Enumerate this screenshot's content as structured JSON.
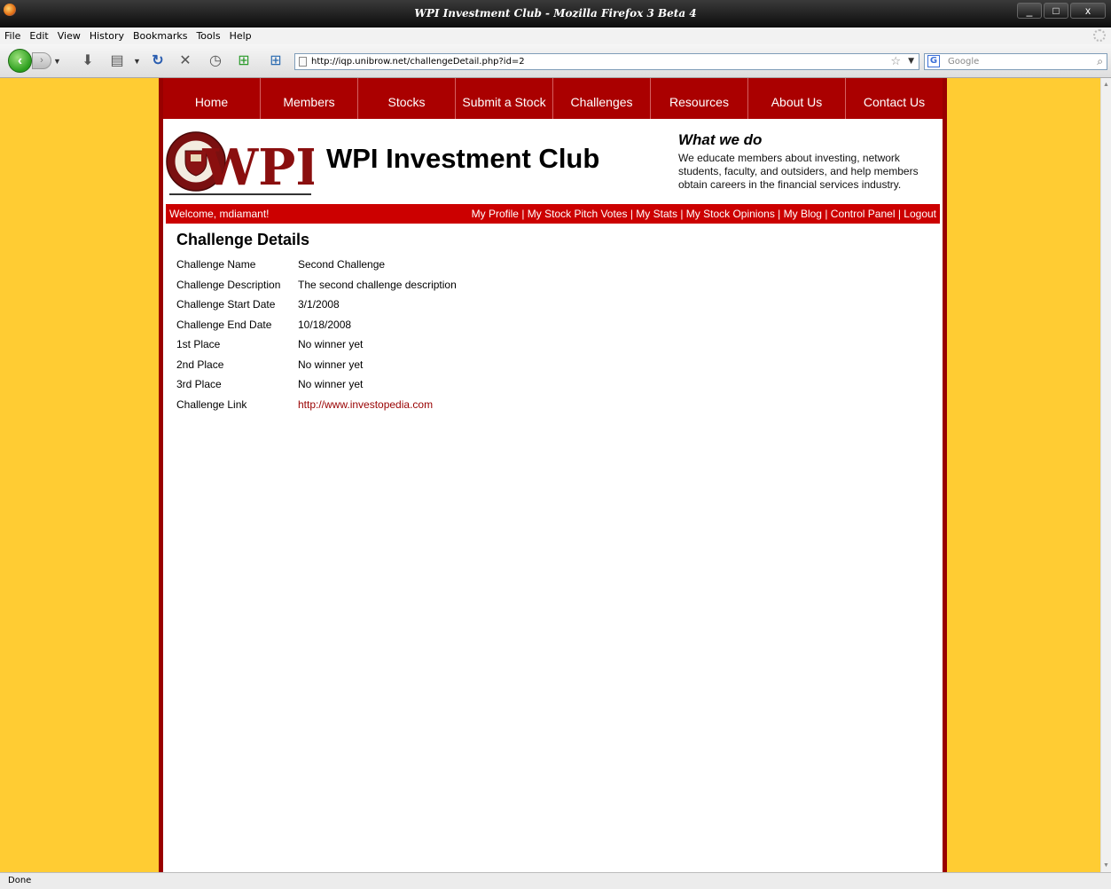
{
  "window": {
    "title": "WPI Investment Club - Mozilla Firefox 3 Beta 4",
    "minimize": "_",
    "maximize": "□",
    "close": "x"
  },
  "menu": [
    "File",
    "Edit",
    "View",
    "History",
    "Bookmarks",
    "Tools",
    "Help"
  ],
  "toolbar": {
    "url": "http://iqp.unibrow.net/challengeDetail.php?id=2",
    "search_placeholder": "Google",
    "icons": [
      "back-icon",
      "forward-icon",
      "download-icon",
      "print-icon",
      "reload-icon",
      "stop-icon",
      "history-icon",
      "add-tab-icon",
      "new-tab-icon"
    ]
  },
  "site": {
    "nav": [
      "Home",
      "Members",
      "Stocks",
      "Submit a Stock",
      "Challenges",
      "Resources",
      "About Us",
      "Contact Us"
    ],
    "logo_text": "WPI",
    "title": "WPI Investment Club",
    "what_title": "What we do",
    "what_text": "We educate members about investing, network students, faculty, and outsiders, and help members obtain careers in the financial services industry.",
    "welcome": "Welcome, mdiamant!",
    "user_links": [
      "My Profile",
      "My Stock Pitch Votes",
      "My Stats",
      "My Stock Opinions",
      "My Blog",
      "Control Panel",
      "Logout"
    ]
  },
  "challenge": {
    "heading": "Challenge Details",
    "rows": [
      {
        "label": "Challenge Name",
        "value": "Second Challenge"
      },
      {
        "label": "Challenge Description",
        "value": "The second challenge description"
      },
      {
        "label": "Challenge Start Date",
        "value": "3/1/2008"
      },
      {
        "label": "Challenge End Date",
        "value": "10/18/2008"
      },
      {
        "label": "1st Place",
        "value": "No winner yet"
      },
      {
        "label": "2nd Place",
        "value": "No winner yet"
      },
      {
        "label": "3rd Place",
        "value": "No winner yet"
      },
      {
        "label": "Challenge Link",
        "value": "http://www.investopedia.com"
      }
    ]
  },
  "status": "Done",
  "colors": {
    "page_bg": "#ffcc33",
    "nav_red": "#aa0000",
    "border_red": "#990000",
    "userbar_red": "#cc0000",
    "link": "#990000"
  }
}
